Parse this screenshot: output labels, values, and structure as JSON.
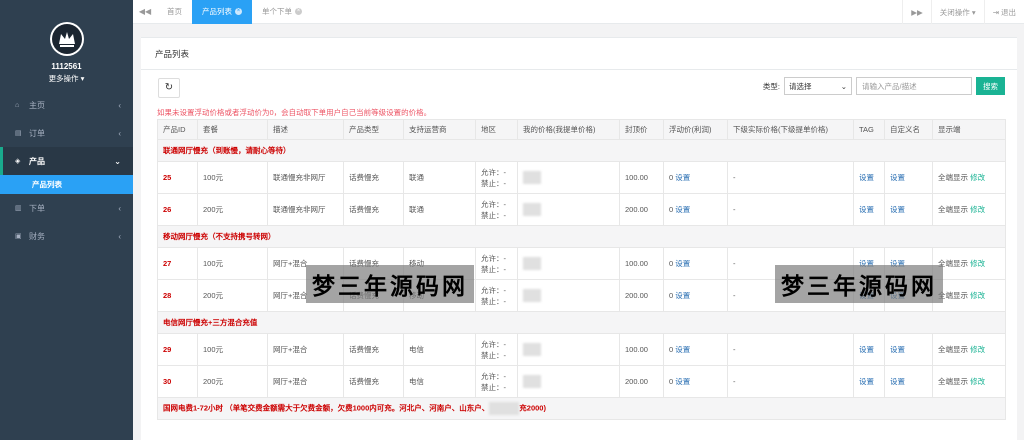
{
  "profile": {
    "user_id": "1112561",
    "more_ops": "更多操作"
  },
  "sidebar": {
    "items": [
      {
        "label": "主页",
        "icon": "home-icon",
        "glyph": "⌂"
      },
      {
        "label": "订单",
        "icon": "order-icon",
        "glyph": "▤"
      },
      {
        "label": "产品",
        "icon": "cube-icon",
        "glyph": "◈",
        "expanded": true
      },
      {
        "label": "下单",
        "icon": "file-icon",
        "glyph": "▥"
      },
      {
        "label": "财务",
        "icon": "money-icon",
        "glyph": "▣"
      }
    ],
    "sub_item": "产品列表"
  },
  "topbar": {
    "tabs": [
      {
        "label": "首页",
        "closable": false
      },
      {
        "label": "产品列表",
        "closable": true,
        "active": true
      },
      {
        "label": "单个下单",
        "closable": true
      }
    ],
    "close_ops": "关闭操作",
    "logout": "退出"
  },
  "panel": {
    "title": "产品列表"
  },
  "toolbar": {
    "type_label": "类型:",
    "select_value": "请选择",
    "search_placeholder": "请输入产品/描述",
    "search_button": "搜索"
  },
  "notice": "如果未设置浮动价格或者浮动价为0，会自动取下单用户自己当前等级设置的价格。",
  "table": {
    "headers": [
      "产品ID",
      "套餐",
      "描述",
      "产品类型",
      "支持运营商",
      "地区",
      "我的价格(我提单价格)",
      "封顶价",
      "浮动价(利润)",
      "下级实际价格(下级提单价格)",
      "TAG",
      "自定义名",
      "显示端"
    ],
    "groups": [
      {
        "title": "联通网厅慢充（到账慢，请耐心等待）",
        "rows": [
          {
            "id": "25",
            "package": "100元",
            "desc": "联通慢充非网厅",
            "type": "话费慢充",
            "carrier": "联通",
            "allow": "允许：-",
            "deny": "禁止：-",
            "cap": "100.00",
            "float_value": "0",
            "float_link": "设置",
            "sub_price": "-",
            "tag": "设置",
            "custom": "设置",
            "display": "全端显示",
            "modify": "修改"
          },
          {
            "id": "26",
            "package": "200元",
            "desc": "联通慢充非网厅",
            "type": "话费慢充",
            "carrier": "联通",
            "allow": "允许：-",
            "deny": "禁止：-",
            "cap": "200.00",
            "float_value": "0",
            "float_link": "设置",
            "sub_price": "-",
            "tag": "设置",
            "custom": "设置",
            "display": "全端显示",
            "modify": "修改"
          }
        ]
      },
      {
        "title": "移动网厅慢充（不支持携号转网）",
        "rows": [
          {
            "id": "27",
            "package": "100元",
            "desc": "网厅+混合",
            "type": "话费慢充",
            "carrier": "移动",
            "allow": "允许：-",
            "deny": "禁止：-",
            "cap": "100.00",
            "float_value": "0",
            "float_link": "设置",
            "sub_price": "-",
            "tag": "设置",
            "custom": "设置",
            "display": "全端显示",
            "modify": "修改"
          },
          {
            "id": "28",
            "package": "200元",
            "desc": "网厅+混合",
            "type": "话费慢充",
            "carrier": "移动",
            "allow": "允许：-",
            "deny": "禁止：-",
            "cap": "200.00",
            "float_value": "0",
            "float_link": "设置",
            "sub_price": "-",
            "tag": "设置",
            "custom": "设置",
            "display": "全端显示",
            "modify": "修改"
          }
        ]
      },
      {
        "title": "电信网厅慢充+三方混合充值",
        "rows": [
          {
            "id": "29",
            "package": "100元",
            "desc": "网厅+混合",
            "type": "话费慢充",
            "carrier": "电信",
            "allow": "允许：-",
            "deny": "禁止：-",
            "cap": "100.00",
            "float_value": "0",
            "float_link": "设置",
            "sub_price": "-",
            "tag": "设置",
            "custom": "设置",
            "display": "全端显示",
            "modify": "修改"
          },
          {
            "id": "30",
            "package": "200元",
            "desc": "网厅+混合",
            "type": "话费慢充",
            "carrier": "电信",
            "allow": "允许：-",
            "deny": "禁止：-",
            "cap": "200.00",
            "float_value": "0",
            "float_link": "设置",
            "sub_price": "-",
            "tag": "设置",
            "custom": "设置",
            "display": "全端显示",
            "modify": "修改"
          }
        ]
      },
      {
        "title": "国网电费1-72小时 （单笔交费金额需大于欠费金额，欠费1000内可充。河北户、河南户、山东户、",
        "title_tail": "充2000)",
        "rows": []
      }
    ]
  },
  "watermark": "梦三年源码网",
  "colors": {
    "sidebar": "#2f4050",
    "accent_blue": "#2aa1f5",
    "accent_green": "#1ab394",
    "danger_red": "#c00"
  }
}
